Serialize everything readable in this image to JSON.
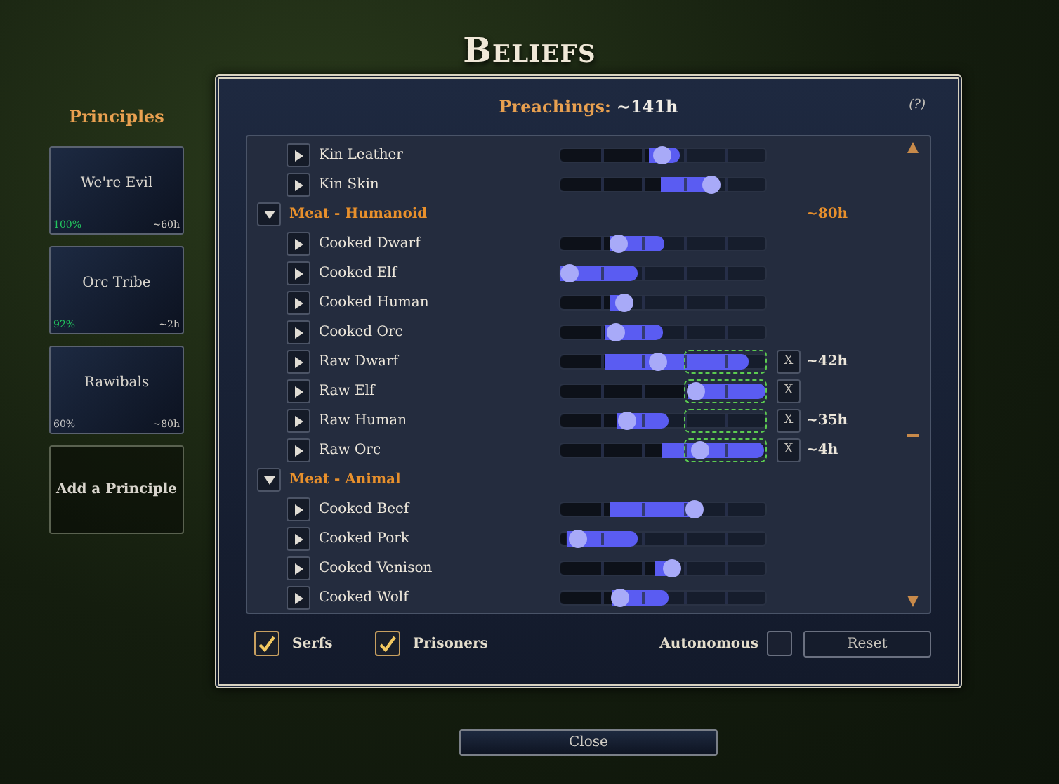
{
  "title": "Beliefs",
  "principles": {
    "heading": "Principles",
    "cards": [
      {
        "name": "We're Evil",
        "percent": "100%",
        "color": "#22c55e",
        "hours": "~60h"
      },
      {
        "name": "Orc Tribe",
        "percent": "92%",
        "color": "#22c55e",
        "hours": "~2h"
      },
      {
        "name": "Rawibals",
        "percent": "60%",
        "color": "#c8c8c8",
        "hours": "~80h"
      }
    ],
    "add_button": "Add a Principle"
  },
  "panel": {
    "preachings_label": "Preachings:",
    "preachings_value": "~141h",
    "help": "(?)",
    "groups": [
      {
        "kind": "continued",
        "children": [
          {
            "label": "Kin Leather",
            "expanded": false,
            "fill": {
              "start": {
                "level": 0.43
              },
              "end": {
                "level": 0.58
              }
            },
            "thumb": {
              "level": 0.49
            },
            "target_zone": false
          },
          {
            "label": "Kin Skin",
            "expanded": false,
            "fill": {
              "start": {
                "level": 0.49
              },
              "end": {
                "level": 0.76
              }
            },
            "thumb": {
              "level": 0.73
            },
            "target_zone": false
          }
        ]
      },
      {
        "kind": "category",
        "label": "Meat - Humanoid",
        "expanded": true,
        "hours": "~80h",
        "children": [
          {
            "label": "Cooked Dwarf",
            "expanded": false,
            "fill": {
              "start": {
                "level": 0.24
              },
              "end": {
                "level": 0.51
              }
            },
            "thumb": {
              "level": 0.28
            },
            "target_zone": false
          },
          {
            "label": "Cooked Elf",
            "expanded": false,
            "fill": {
              "start": {
                "level": 0.0
              },
              "end": {
                "level": 0.38
              }
            },
            "thumb": {
              "level": 0.04
            },
            "target_zone": false
          },
          {
            "label": "Cooked Human",
            "expanded": false,
            "fill": {
              "start": {
                "level": 0.24
              },
              "end": {
                "level": 0.35
              }
            },
            "thumb": {
              "level": 0.31
            },
            "target_zone": false
          },
          {
            "label": "Cooked Orc",
            "expanded": false,
            "fill": {
              "start": {
                "level": 0.22
              },
              "end": {
                "level": 0.5
              }
            },
            "thumb": {
              "level": 0.27
            },
            "target_zone": false
          },
          {
            "label": "Raw Dwarf",
            "expanded": false,
            "fill": {
              "start": {
                "level": 0.22
              },
              "end": {
                "level": 0.92
              }
            },
            "thumb": {
              "level": 0.47
            },
            "target_zone": true,
            "clear": "X",
            "hours": "~42h"
          },
          {
            "label": "Raw Elf",
            "expanded": false,
            "fill": {
              "start": {
                "level": 0.62
              },
              "end": {
                "level": 1.0
              }
            },
            "thumb": {
              "level": 0.66
            },
            "target_zone": true,
            "clear": "X"
          },
          {
            "label": "Raw Human",
            "expanded": false,
            "fill": {
              "start": {
                "level": 0.28
              },
              "end": {
                "level": 0.53
              }
            },
            "thumb": {
              "level": 0.32
            },
            "target_zone": true,
            "clear": "X",
            "hours": "~35h"
          },
          {
            "label": "Raw Orc",
            "expanded": false,
            "fill": {
              "start": {
                "level": 0.49
              },
              "end": {
                "level": 0.99
              }
            },
            "thumb": {
              "level": 0.68
            },
            "target_zone": true,
            "clear": "X",
            "hours": "~4h"
          }
        ]
      },
      {
        "kind": "category",
        "label": "Meat - Animal",
        "expanded": true,
        "children": [
          {
            "label": "Cooked Beef",
            "expanded": false,
            "fill": {
              "start": {
                "level": 0.24
              },
              "end": {
                "level": 0.69
              }
            },
            "thumb": {
              "level": 0.65
            },
            "target_zone": false
          },
          {
            "label": "Cooked Pork",
            "expanded": false,
            "fill": {
              "start": {
                "level": 0.03
              },
              "end": {
                "level": 0.38
              }
            },
            "thumb": {
              "level": 0.08
            },
            "target_zone": false
          },
          {
            "label": "Cooked Venison",
            "expanded": false,
            "fill": {
              "start": {
                "level": 0.46
              },
              "end": {
                "level": 0.55
              }
            },
            "thumb": {
              "level": 0.54
            },
            "target_zone": false
          },
          {
            "label": "Cooked Wolf",
            "expanded": false,
            "fill": {
              "start": {
                "level": 0.25
              },
              "end": {
                "level": 0.53
              }
            },
            "thumb": {
              "level": 0.29
            },
            "target_zone": false
          }
        ]
      }
    ],
    "options": [
      {
        "label": "Serfs",
        "checked": true
      },
      {
        "label": "Prisoners",
        "checked": true
      }
    ],
    "autonomous": {
      "label": "Autonomous",
      "checked": false
    },
    "reset_button": "Reset"
  },
  "close_button": "Close"
}
